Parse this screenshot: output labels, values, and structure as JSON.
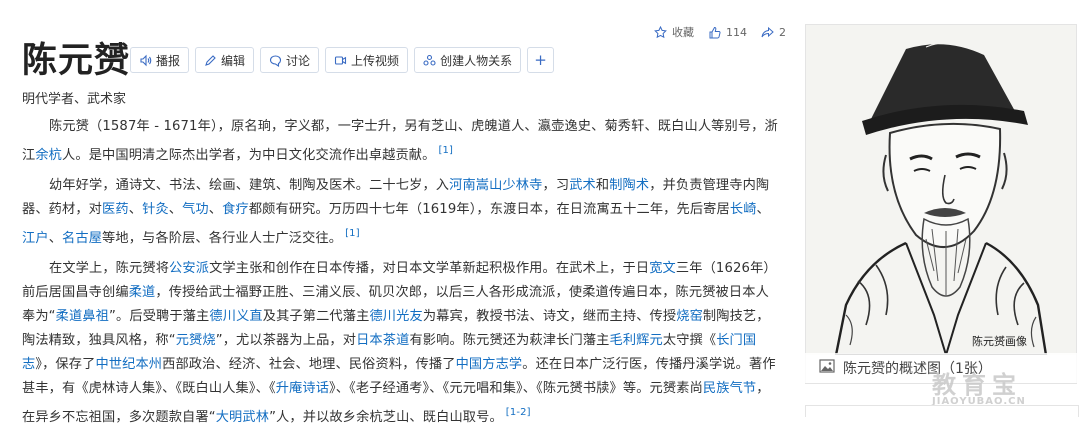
{
  "entry": {
    "title": "陈元赟",
    "subtitle": "明代学者、武术家"
  },
  "toolbar": {
    "play": "播报",
    "edit": "编辑",
    "discuss": "讨论",
    "upload_video": "上传视频",
    "relation": "创建人物关系",
    "add": "+"
  },
  "stats": {
    "collect": "收藏",
    "likes": "114",
    "shares": "2"
  },
  "p1": {
    "t1": "陈元赟（1587年 - 1671年），原名珦，字义都，一字士升，另有芝山、虎魄道人、瀛壶逸史、菊秀轩、既白山人等别号，浙江",
    "l1": "余杭",
    "t2": "人。是中国明清之际杰出学者，为中日文化交流作出卓越贡献。",
    "ref": "[1]"
  },
  "p2": {
    "t1": "幼年好学，通诗文、书法、绘画、建筑、制陶及医术。二十七岁，入",
    "l1": "河南嵩山少林寺",
    "t2": "，习",
    "l2": "武术",
    "t3": "和",
    "l3": "制陶术",
    "t4": "，并负责管理寺内陶器、药材，对",
    "l4": "医药",
    "t5": "、",
    "l5": "针灸",
    "t6": "、",
    "l6": "气功",
    "t7": "、",
    "l7": "食疗",
    "t8": "都颇有研究。万历四十七年（1619年），东渡日本，在日流寓五十二年，先后寄居",
    "l8": "长崎",
    "t9": "、",
    "l9": "江户",
    "t10": "、",
    "l10": "名古屋",
    "t11": "等地，与各阶层、各行业人士广泛交往。",
    "ref": "[1]"
  },
  "p3": {
    "t1": "在文学上，陈元赟将",
    "l1": "公安派",
    "t2": "文学主张和创作在日本传播，对日本文学革新起积极作用。在武术上，于日",
    "l2": "宽文",
    "t3": "三年（1626年）前后居国昌寺创编",
    "l3": "柔道",
    "t4": "，传授给武士福野正胜、三浦义辰、矶贝次郎，以后三人各形成流派，使柔道传遍日本，陈元赟被日本人奉为“",
    "l4": "柔道鼻祖",
    "t5": "”。后受聘于藩主",
    "l5": "德川义直",
    "t6": "及其子第二代藩主",
    "l6": "德川光友",
    "t7": "为幕宾，教授书法、诗文，继而主持、传授",
    "l7": "烧窑",
    "t8": "制陶技艺，陶法精致，独具风格，称“",
    "l8": "元赟烧",
    "t9": "”，尤以茶器为上品，对",
    "l9": "日本茶道",
    "t10": "有影响。陈元赟还为萩津长门藩主",
    "l10": "毛利辉元",
    "t11": "太守撰《",
    "l11": "长门国志",
    "t12": "》，保存了",
    "l12": "中世纪本州",
    "t13": "西部政治、经济、社会、地理、民俗资料，传播了",
    "l13": "中国方志学",
    "t14": "。还在日本广泛行医，传播丹溪学说。著作甚丰，有《虎林诗人集》、《既白山人集》、《",
    "l14": "升庵诗话",
    "t15": "》、《老子经通考》、《元元唱和集》、《陈元赟书牍》等。元赟素尚",
    "l15": "民族气节",
    "t16": "，在异乡不忘祖国，多次题款自署“",
    "l16": "大明武林",
    "t17": "”人，并以故乡余杭芝山、既白山取号。",
    "ref": "[1-2]"
  },
  "album": {
    "portrait_caption": "陈元赟画像",
    "caption": "陈元赟的概述图（1张）"
  },
  "watermark": {
    "cn": "教育宝",
    "en": "JIAOYUBAO.CN"
  },
  "colors": {
    "link": "#136ec2",
    "text": "#333333",
    "border": "#d5dde8",
    "icon": "#3a6bc3"
  },
  "icons": [
    "speaker-icon",
    "pencil-icon",
    "chat-icon",
    "video-icon",
    "people-icon",
    "star-icon",
    "thumb-up-icon",
    "share-icon",
    "image-icon"
  ]
}
